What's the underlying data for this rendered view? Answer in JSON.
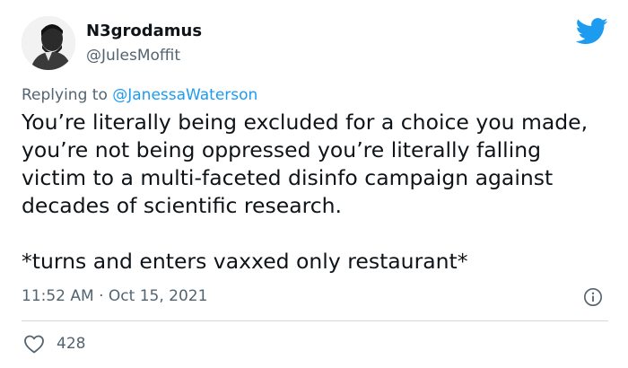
{
  "author": {
    "display_name": "N3grodamus",
    "handle": "@JulesMoffit",
    "avatar_icon": "user-avatar"
  },
  "reply": {
    "prefix": "Replying to ",
    "mention": "@JanessaWaterson"
  },
  "tweet": {
    "text": "You’re literally being excluded for a choice you made, you’re not being oppressed you’re literally falling victim to a multi-faceted disinfo campaign against decades of scientific research.\n\n*turns and enters vaxxed only restaurant*",
    "timestamp": "11:52 AM · Oct 15, 2021"
  },
  "engagement": {
    "likes": "428"
  },
  "icons": {
    "brand": "twitter-bird-icon",
    "info": "info-icon",
    "like": "heart-icon"
  },
  "colors": {
    "brand_blue": "#1d9bf0",
    "text_primary": "#0f1419",
    "text_secondary": "#536471",
    "divider": "#cfd9de"
  }
}
